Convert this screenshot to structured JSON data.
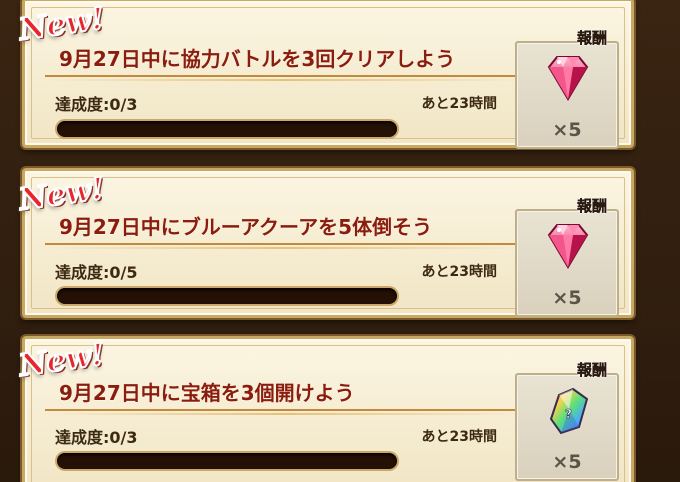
{
  "missions": [
    {
      "badge": "New!",
      "title": "9月27日中に協力バトルを3回クリアしよう",
      "progress_text": "達成度:0/3",
      "progress_fraction": 0,
      "time_left": "あと23時間",
      "reward_label": "報酬",
      "reward_icon": "pink-gem-icon",
      "reward_qty": "×5"
    },
    {
      "badge": "New!",
      "title": "9月27日中にブルーアクーアを5体倒そう",
      "progress_text": "達成度:0/5",
      "progress_fraction": 0,
      "time_left": "あと23時間",
      "reward_label": "報酬",
      "reward_icon": "pink-gem-icon",
      "reward_qty": "×5"
    },
    {
      "badge": "New!",
      "title": "9月27日中に宝箱を3個開けよう",
      "progress_text": "達成度:0/3",
      "progress_fraction": 0,
      "time_left": "あと23時間",
      "reward_label": "報酬",
      "reward_icon": "rainbow-crystal-icon",
      "reward_qty": "×5"
    }
  ],
  "colors": {
    "title": "#8a1c10",
    "badge": "#e8262b",
    "gem": "#e8336a",
    "bar_track": "#241004"
  }
}
